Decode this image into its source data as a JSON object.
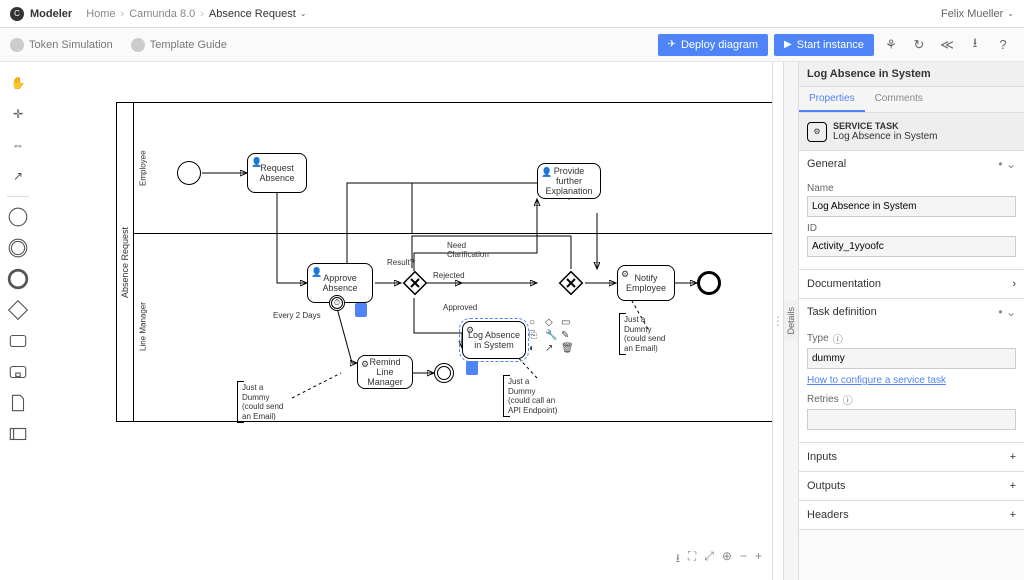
{
  "header": {
    "brand": "Modeler",
    "crumb1": "Home",
    "crumb2": "Camunda 8.0",
    "crumb3": "Absence Request",
    "user": "Felix Mueller"
  },
  "subbar": {
    "tokenSim": "Token Simulation",
    "templateGuide": "Template Guide",
    "deploy": "Deploy diagram",
    "start": "Start instance"
  },
  "diagram": {
    "pool": "Absence Request",
    "lane1": "Employee",
    "lane2": "Line Manager",
    "tasks": {
      "request": "Request Absence",
      "approve": "Approve Absence",
      "provide": "Provide further Explanation",
      "remind": "Remind Line Manager",
      "log": "Log Absence in System",
      "notify": "Notify Employee"
    },
    "labels": {
      "result": "Result?",
      "rejected": "Rejected",
      "approved": "Approved",
      "needClarification": "Need Clarification",
      "every2Days": "Every 2 Days"
    },
    "annotations": {
      "a1": "Just a Dummy (could send an Email)",
      "a2": "Just a Dummy (could call an API Endpoint)",
      "a3": "Just a Dummy (could send an Email)"
    }
  },
  "props": {
    "title": "Log Absence in System",
    "tab1": "Properties",
    "tab2": "Comments",
    "typeLabel": "SERVICE TASK",
    "typeName": "Log Absence in System",
    "sections": {
      "general": "General",
      "doc": "Documentation",
      "taskDef": "Task definition",
      "inputs": "Inputs",
      "outputs": "Outputs",
      "headers": "Headers"
    },
    "fields": {
      "nameLabel": "Name",
      "nameValue": "Log Absence in System",
      "idLabel": "ID",
      "idValue": "Activity_1yyoofc",
      "typeLabel": "Type",
      "typeValue": "dummy",
      "retriesLabel": "Retries",
      "retriesValue": "",
      "link": "How to configure a service task"
    },
    "sideTab": "Details"
  }
}
